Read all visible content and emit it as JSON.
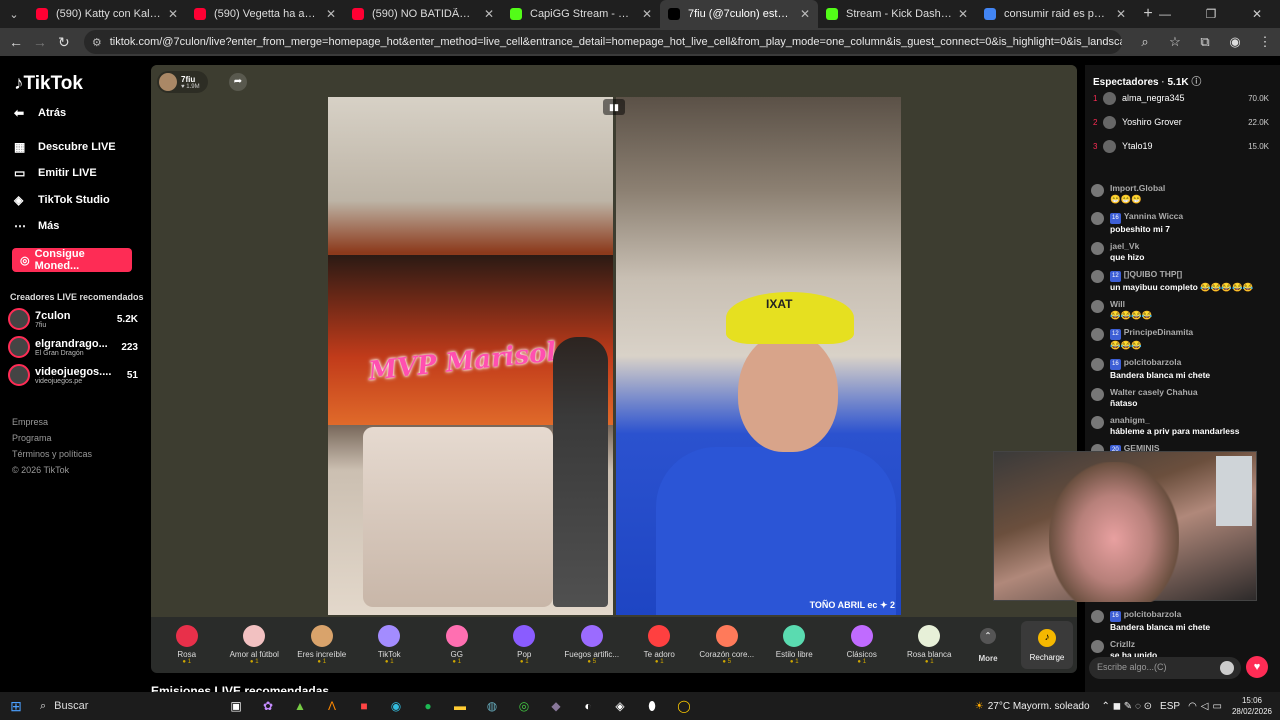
{
  "browser": {
    "tabs": [
      {
        "title": "(590) Katty con Kalle - YouTube",
        "color": "#ff0033"
      },
      {
        "title": "(590) Vegetta ha aprendido un",
        "color": "#ff0033"
      },
      {
        "title": "(590) NO BATIDÃO - ZXKAI - Yo",
        "color": "#ff0033"
      },
      {
        "title": "CapiGG Stream - Watch Live on",
        "color": "#53fc18"
      },
      {
        "title": "7fiu (@7culon) está emitien",
        "color": "#000000"
      },
      {
        "title": "Stream - Kick Dashboard",
        "color": "#53fc18"
      },
      {
        "title": "consumir raid es peligroso - Bu",
        "color": "#4285f4"
      }
    ],
    "url": "tiktok.com/@7culon/live?enter_from_merge=homepage_hot&enter_method=live_cell&entrance_detail=homepage_hot_live_cell&from_play_mode=one_column&is_guest_connect=0&is_highlight=0&is_landscape=0&request_id=20260301024755BD..."
  },
  "sidebar": {
    "logo": "TikTok",
    "back": "Atrás",
    "nav": [
      "Descubre LIVE",
      "Emitir LIVE",
      "TikTok Studio",
      "Más"
    ],
    "coins_button": "Consigue Moned...",
    "recommended_title": "Creadores LIVE recomendados",
    "creators": [
      {
        "name": "7culon",
        "sub": "7fiu",
        "count": "5.2K"
      },
      {
        "name": "elgrandrago...",
        "sub": "El Gran Dragón",
        "count": "223"
      },
      {
        "name": "videojuegos....",
        "sub": "videojuegos.pe",
        "count": "51"
      }
    ],
    "footer": [
      "Empresa",
      "Programa",
      "Términos y políticas",
      "© 2026 TikTok"
    ]
  },
  "stream": {
    "host_name": "7fiu",
    "host_likes": "1.9M",
    "poster_text": "MVP Marisol",
    "hat_text": "IXAT",
    "right_caption": "TOÑO ABRIL ec",
    "right_score": "2",
    "gifts": [
      {
        "name": "Rosa",
        "price": "1",
        "color": "#e8304a"
      },
      {
        "name": "Amor al fútbol",
        "price": "1",
        "color": "#f2c1c1"
      },
      {
        "name": "Eres increíble",
        "price": "1",
        "color": "#d9a36b"
      },
      {
        "name": "TikTok",
        "price": "1",
        "color": "#a38cff"
      },
      {
        "name": "GG",
        "price": "1",
        "color": "#ff6fb1"
      },
      {
        "name": "Pop",
        "price": "1",
        "color": "#8a5cff"
      },
      {
        "name": "Fuegos artific...",
        "price": "5",
        "color": "#9b6bff"
      },
      {
        "name": "Te adoro",
        "price": "1",
        "color": "#ff4040"
      },
      {
        "name": "Corazón core...",
        "price": "5",
        "color": "#ff7a5a"
      },
      {
        "name": "Estilo libre",
        "price": "1",
        "color": "#5adbb0"
      },
      {
        "name": "Clásicos",
        "price": "1",
        "color": "#c06bff"
      },
      {
        "name": "Rosa blanca",
        "price": "1",
        "color": "#e7f0d8"
      }
    ],
    "more_label": "More",
    "recharge_label": "Recharge"
  },
  "recommended_live_heading": "Emisiones LIVE recomendadas",
  "chat": {
    "viewers_label": "Espectadores",
    "viewers_count": "5.1K",
    "top_viewers": [
      {
        "rank": "1",
        "name": "alma_negra345",
        "score": "70.0K"
      },
      {
        "rank": "2",
        "name": "Yoshiro Grover",
        "score": "22.0K"
      },
      {
        "rank": "3",
        "name": "Ytalo19",
        "score": "15.0K"
      }
    ],
    "messages": [
      {
        "user": "Import.Global",
        "badge": "",
        "text": "😁😁😁"
      },
      {
        "user": "Yannina Wicca",
        "badge": "16",
        "text": "pobeshito mi 7"
      },
      {
        "user": "jael_Vk",
        "badge": "",
        "text": "que hizo"
      },
      {
        "user": "[]QUIBO THP[]",
        "badge": "12",
        "text": "un mayibuu completo 😂😂😂😂😂"
      },
      {
        "user": "Will",
        "badge": "",
        "text": "😂😂😂😂"
      },
      {
        "user": "PrincipeDinamita",
        "badge": "12",
        "text": "😂😂😂"
      },
      {
        "user": "polcitobarzola",
        "badge": "16",
        "text": "Bandera blanca mi chete"
      },
      {
        "user": "Walter casely Chahua",
        "badge": "",
        "text": "ñataso"
      },
      {
        "user": "anahigm_",
        "badge": "",
        "text": "hábleme a priv para mandarless"
      },
      {
        "user": "GEMINIS",
        "badge": "20",
        "text": ""
      }
    ],
    "bottom_messages": [
      {
        "user": "polcitobarzola",
        "badge": "16",
        "text": "Bandera blanca mi chete"
      },
      {
        "user": "Crizllz",
        "badge": "",
        "text": "se ha unido"
      }
    ],
    "input_placeholder": "Escribe algo...(C)"
  },
  "taskbar": {
    "search": "Buscar",
    "weather": "27°C  Mayorm. soleado",
    "lang": "ESP",
    "time": "15:06",
    "date": "28/02/2026"
  }
}
